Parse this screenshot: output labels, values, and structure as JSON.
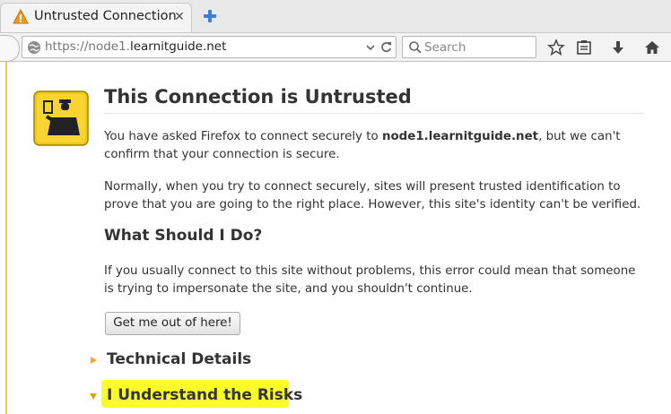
{
  "tab": {
    "title": "Untrusted Connection",
    "icon": "warning-icon",
    "close_glyph": "✕"
  },
  "toolbar": {
    "url_prefix": "https://node1.",
    "url_domain": "learnitguide.net",
    "search_placeholder": "Search"
  },
  "page": {
    "title": "This Connection is Untrusted",
    "para1_before": "You have asked Firefox to connect securely to ",
    "para1_host": "node1.learnitguide.net",
    "para1_after": ", but we can't confirm that your connection is secure.",
    "para2": "Normally, when you try to connect securely, sites will present trusted identification to prove that you are going to the right place. However, this site's identity can't be verified.",
    "what_heading": "What Should I Do?",
    "para3": "If you usually connect to this site without problems, this error could mean that someone is trying to impersonate the site, and you shouldn't continue.",
    "get_out_label": "Get me out of here!",
    "technical_details": "Technical Details",
    "understand_risks": "I Understand the Risks"
  },
  "colors": {
    "accent_orange": "#f5a623",
    "highlight_yellow": "#fbfb29",
    "page_text": "#333333"
  }
}
